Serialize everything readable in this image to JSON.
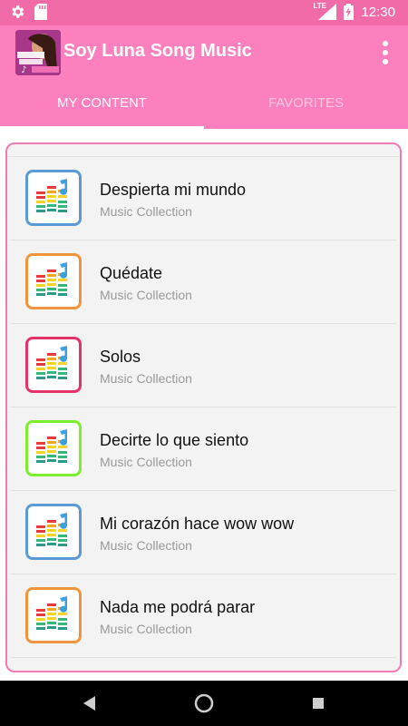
{
  "status_bar": {
    "time": "12:30",
    "network": "LTE",
    "icons": [
      "settings-icon",
      "sd-card-icon",
      "signal-icon",
      "battery-icon"
    ]
  },
  "app_bar": {
    "title": "Soy Luna Song Music",
    "logo_icon": "app-logo-icon",
    "menu_icon": "overflow-menu-icon"
  },
  "tabs": [
    {
      "label": "MY CONTENT",
      "active": true
    },
    {
      "label": "FAVORITES",
      "active": false
    }
  ],
  "list": {
    "items": [
      {
        "title": "Despierta mi mundo",
        "subtitle": "Music Collection",
        "border_color": "#5b9bd5"
      },
      {
        "title": "Quédate",
        "subtitle": "Music Collection",
        "border_color": "#f0953d"
      },
      {
        "title": "Solos",
        "subtitle": "Music Collection",
        "border_color": "#e5336a"
      },
      {
        "title": "Decirte lo que siento",
        "subtitle": "Music Collection",
        "border_color": "#7bef2c"
      },
      {
        "title": "Mi corazón hace wow wow",
        "subtitle": "Music Collection",
        "border_color": "#5b9bd5"
      },
      {
        "title": "Nada me podrá parar",
        "subtitle": "Music Collection",
        "border_color": "#f0953d"
      }
    ]
  },
  "colors": {
    "status_bar": "#f26ba9",
    "app_bar": "#fc80bd",
    "list_border": "#f27ab3"
  },
  "nav_bar": {
    "back_icon": "back-triangle-icon",
    "home_icon": "home-circle-icon",
    "recents_icon": "recents-square-icon"
  }
}
